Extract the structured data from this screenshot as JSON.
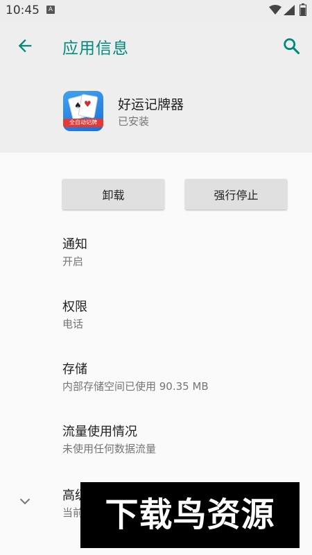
{
  "status_bar": {
    "time": "10:45",
    "notification_glyph": "A"
  },
  "app_bar": {
    "title": "应用信息",
    "back_icon": "arrow-left-icon",
    "search_icon": "search-icon",
    "accent_color": "#00897b"
  },
  "app": {
    "name": "好运记牌器",
    "status": "已安装",
    "icon_badge": "全自动记牌"
  },
  "buttons": {
    "uninstall": "卸载",
    "force_stop": "强行停止"
  },
  "settings": [
    {
      "title": "通知",
      "subtitle": "开启"
    },
    {
      "title": "权限",
      "subtitle": "电话"
    },
    {
      "title": "存储",
      "subtitle": "内部存储空间已使用 90.35 MB"
    },
    {
      "title": "流量使用情况",
      "subtitle": "未使用任何数据流量"
    },
    {
      "title": "高级",
      "subtitle": "当前"
    }
  ],
  "watermark": {
    "text": "下载鸟资源"
  }
}
